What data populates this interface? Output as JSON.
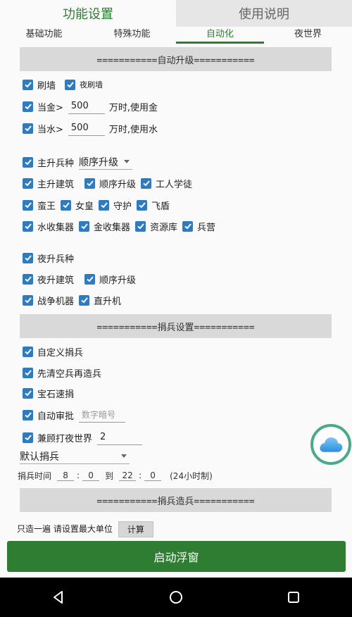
{
  "top_tabs": {
    "settings": "功能设置",
    "help": "使用说明"
  },
  "sub_tabs": [
    "基础功能",
    "特殊功能",
    "自动化",
    "夜世界"
  ],
  "sections": {
    "auto_upgrade": "===========自动升级===========",
    "donate_settings": "===========捐兵设置===========",
    "donate_train": "===========捐兵造兵==========="
  },
  "auto_upgrade": {
    "wall": "刷墙",
    "night_wall": "夜刷墙",
    "gold_prefix": "当金>",
    "gold_value": "500",
    "gold_suffix": "万时,使用金",
    "elixir_prefix": "当水>",
    "elixir_value": "500",
    "elixir_suffix": "万时,使用水",
    "main_troops": "主升兵种",
    "troop_order": "顺序升级",
    "main_buildings": "主升建筑",
    "order_upgrade": "顺序升级",
    "builder_apprentice": "工人学徒",
    "barbarian_king": "蛮王",
    "archer_queen": "女皇",
    "warden": "守护",
    "royal_champion": "飞盾",
    "elixir_collector": "水收集器",
    "gold_mine": "金收集器",
    "storage": "资源库",
    "barracks": "兵营",
    "night_troops": "夜升兵种",
    "night_buildings": "夜升建筑",
    "night_order": "顺序升级",
    "war_machine": "战争机器",
    "helicopter": "直升机"
  },
  "donate": {
    "custom": "自定义捐兵",
    "clear_then_train": "先清空兵再造兵",
    "gem_donate": "宝石速捐",
    "auto_approve": "自动审批",
    "code_placeholder": "数字暗号",
    "night_world": "兼顾打夜世界",
    "night_world_value": "2",
    "default_donate": "默认捐兵",
    "time_label": "捐兵时间",
    "start_h": "8",
    "start_m": "0",
    "to": "到",
    "end_h": "22",
    "end_m": "0",
    "hint": "(24小时制)"
  },
  "cut_row": {
    "text": "只造一遍 请设置最大单位",
    "calc": "计算"
  },
  "start_button": "启动浮窗",
  "colors": {
    "accent": "#2e7d32",
    "checkbox": "#2f7bbf",
    "float_ring": "#4aa98a"
  }
}
